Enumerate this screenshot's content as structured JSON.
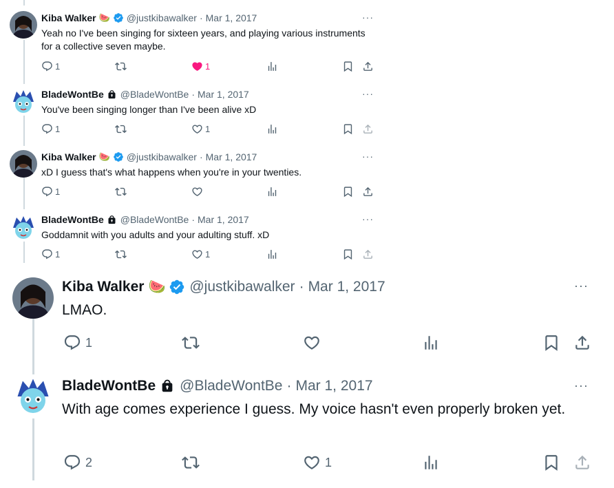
{
  "tweets": [
    {
      "name": "Kiba Walker",
      "emoji": "🍉",
      "verified": true,
      "handle": "@justkibawalker",
      "date": "Mar 1, 2017",
      "text": "Yeah no I've been singing for sixteen years, and playing various instruments for a collective seven maybe.",
      "replies": "1",
      "retweets": "",
      "likes": "1",
      "liked": true
    },
    {
      "name": "BladeWontBe",
      "locked": true,
      "handle": "@BladeWontBe",
      "date": "Mar 1, 2017",
      "text": "You've been singing longer than I've been alive xD",
      "replies": "1",
      "retweets": "",
      "likes": "1",
      "liked": false
    },
    {
      "name": "Kiba Walker",
      "emoji": "🍉",
      "verified": true,
      "handle": "@justkibawalker",
      "date": "Mar 1, 2017",
      "text": "xD I guess that's what happens when you're in your twenties.",
      "replies": "1",
      "retweets": "",
      "likes": "",
      "liked": false
    },
    {
      "name": "BladeWontBe",
      "locked": true,
      "handle": "@BladeWontBe",
      "date": "Mar 1, 2017",
      "text": "Goddamnit with you adults and your adulting stuff. xD",
      "replies": "1",
      "retweets": "",
      "likes": "1",
      "liked": false
    },
    {
      "name": "Kiba Walker",
      "emoji": "🍉",
      "verified": true,
      "handle": "@justkibawalker",
      "date": "Mar 1, 2017",
      "text": "LMAO.",
      "replies": "1",
      "retweets": "",
      "likes": "",
      "liked": false
    },
    {
      "name": "BladeWontBe",
      "locked": true,
      "handle": "@BladeWontBe",
      "date": "Mar 1, 2017",
      "text": "With age comes experience I guess. My voice hasn't even properly broken yet.",
      "replies": "2",
      "retweets": "",
      "likes": "1",
      "liked": false
    }
  ],
  "separator": "·",
  "more_glyph": "···",
  "icons": [
    "reply-icon",
    "retweet-icon",
    "like-icon",
    "views-icon",
    "bookmark-icon",
    "share-icon",
    "verified-badge-icon",
    "lock-icon"
  ],
  "colors": {
    "accent": "#1d9bf0",
    "like": "#f91880",
    "muted_text": "#536471",
    "text": "#0f1419",
    "thread_line": "#cfd9de"
  }
}
